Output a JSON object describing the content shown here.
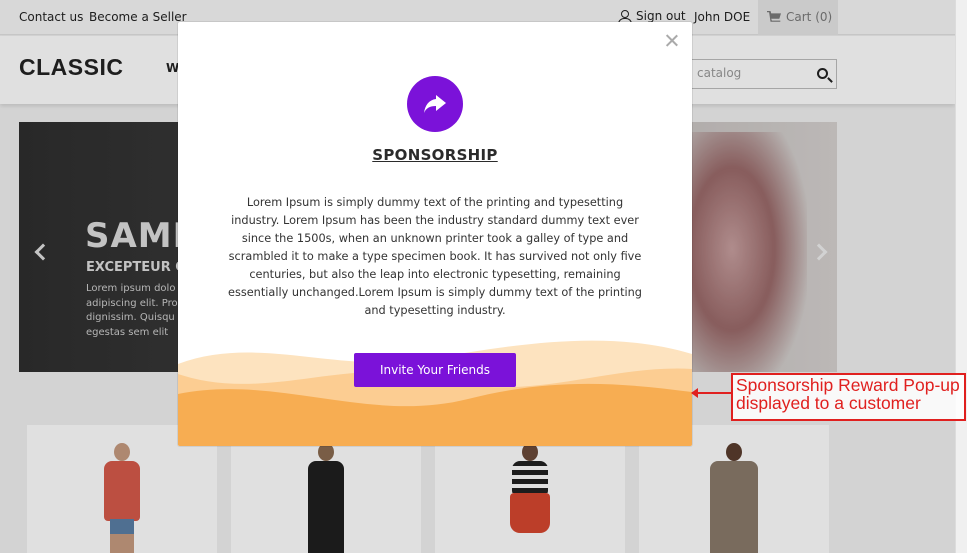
{
  "topbar": {
    "contact_label": "Contact us",
    "seller_label": "Become a Seller",
    "signout_label": "Sign out",
    "user_name": "John DOE",
    "cart_label": "Cart",
    "cart_count": "(0)"
  },
  "header": {
    "logo": "CLASSIC",
    "menu_partial": "W",
    "search_placeholder": "catalog"
  },
  "slider": {
    "title_partial": "SAMP",
    "subtitle_partial": "EXCEPTEUR O",
    "text_partial": "Lorem ipsum dolo adipiscing elit. Pro dignissim. Quisqu egestas sem elit"
  },
  "modal": {
    "title": "SPONSORSHIP",
    "body": "Lorem Ipsum is simply dummy text of the printing and typesetting industry. Lorem Ipsum has been the industry standard dummy text ever since the 1500s, when an unknown printer took a galley of type and scrambled it to make a type specimen book. It has survived not only five centuries, but also the leap into electronic typesetting, remaining essentially unchanged.Lorem Ipsum is simply dummy text of the printing and typesetting industry.",
    "button_label": "Invite Your Friends",
    "icon": "share-arrow-icon"
  },
  "annotation": {
    "text": "Sponsorship Reward Pop-up displayed to a customer"
  },
  "colors": {
    "accent": "#7b12d9",
    "wave_light": "#fcd9a8",
    "wave_dark": "#f7ad52",
    "annotation": "#e0201f"
  }
}
